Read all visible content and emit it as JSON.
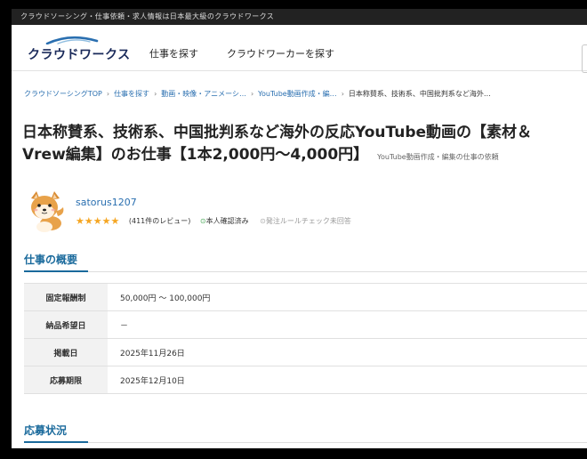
{
  "top_bar": {
    "tagline": "クラウドソーシング・仕事依頼・求人情報は日本最大級のクラウドワークス"
  },
  "header": {
    "logo_text": "クラウドワークス",
    "nav": [
      {
        "label": "仕事を探す"
      },
      {
        "label": "クラウドワーカーを探す"
      }
    ]
  },
  "breadcrumb": {
    "items": [
      {
        "label": "クラウドソーシングTOP"
      },
      {
        "label": "仕事を探す"
      },
      {
        "label": "動画・映像・アニメーシ…"
      },
      {
        "label": "YouTube動画作成・編…"
      },
      {
        "label": "日本称賛系、技術系、中国批判系など海外…"
      }
    ],
    "separator": "›"
  },
  "job": {
    "title": "日本称賛系、技術系、中国批判系など海外の反応YouTube動画の【素材＆Vrew編集】のお仕事【1本2,000円〜4,000円】",
    "category_note": "YouTube動画作成・編集の仕事の依頼"
  },
  "client": {
    "username": "satorus1207",
    "stars": "★★★★★",
    "rating": 5,
    "review_count": "(411件のレビュー)",
    "verified_label": "本人確認済み",
    "rule_check_label": "発注ルールチェック未回答"
  },
  "overview": {
    "heading": "仕事の概要",
    "rows": [
      {
        "label": "固定報酬制",
        "value": "50,000円 〜 100,000円"
      },
      {
        "label": "納品希望日",
        "value": "－"
      },
      {
        "label": "掲載日",
        "value": "2025年11月26日"
      },
      {
        "label": "応募期限",
        "value": "2025年12月10日"
      }
    ]
  },
  "applications": {
    "heading": "応募状況"
  },
  "colors": {
    "link": "#2a6fb0",
    "accent": "#1a6a9c",
    "star": "#f5a623",
    "verified": "#4caa5a"
  },
  "icons": {
    "logo": "crowdworks-logo-swoosh",
    "verified": "check-circle-icon",
    "rule": "check-circle-outline-icon",
    "avatar": "shiba-dog-avatar"
  }
}
